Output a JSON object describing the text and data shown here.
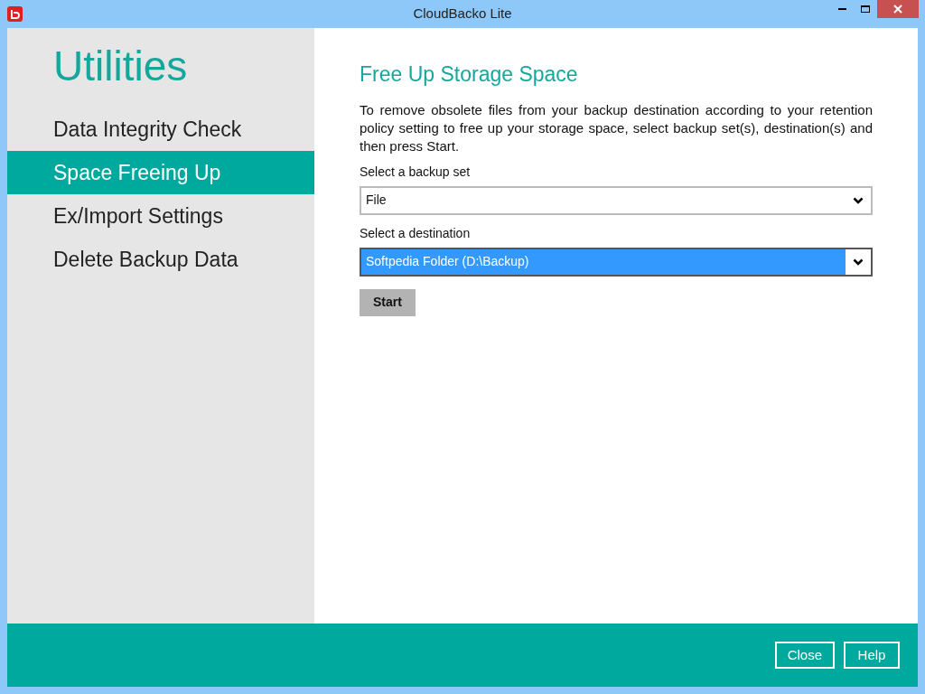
{
  "window": {
    "title": "CloudBacko Lite"
  },
  "sidebar": {
    "title": "Utilities",
    "items": [
      {
        "label": "Data Integrity Check",
        "selected": false
      },
      {
        "label": "Space Freeing Up",
        "selected": true
      },
      {
        "label": "Ex/Import Settings",
        "selected": false
      },
      {
        "label": "Delete Backup Data",
        "selected": false
      }
    ]
  },
  "content": {
    "title": "Free Up Storage Space",
    "description": "To remove obsolete files from your backup destination according to your retention policy setting to free up your storage space, select backup set(s), destination(s) and then press Start.",
    "fields": [
      {
        "label": "Select a backup set",
        "value": "File",
        "focused": false
      },
      {
        "label": "Select a destination",
        "value": "Softpedia Folder (D:\\Backup)",
        "focused": true
      }
    ],
    "start_button": "Start"
  },
  "footer": {
    "buttons": [
      "Close",
      "Help"
    ]
  }
}
